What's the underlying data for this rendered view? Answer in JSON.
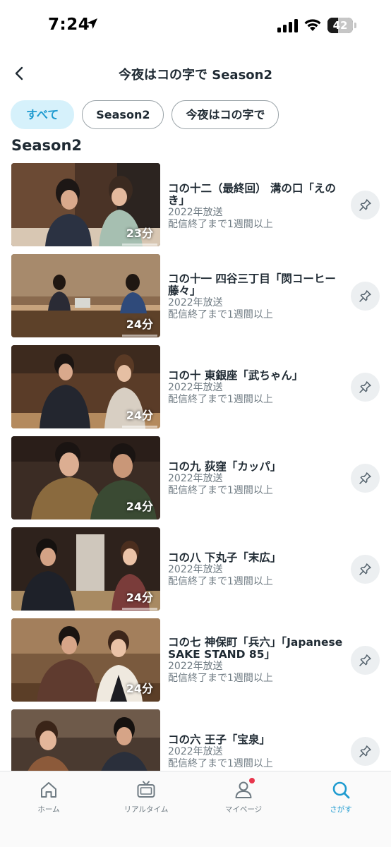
{
  "status_bar": {
    "time": "7:24",
    "battery": "42"
  },
  "header": {
    "title": "今夜はコの字で Season2"
  },
  "filters": [
    {
      "label": "すべて",
      "active": true
    },
    {
      "label": "Season2",
      "active": false
    },
    {
      "label": "今夜はコの字で",
      "active": false
    }
  ],
  "section": {
    "title": "Season2"
  },
  "episodes": [
    {
      "title": "コの十二（最終回） 溝の口「えのき」",
      "year": "2022年放送",
      "availability": "配信終了まで1週間以上",
      "duration": "23分"
    },
    {
      "title": "コの十一 四谷三丁目「焛コーヒー藤々」",
      "year": "2022年放送",
      "availability": "配信終了まで1週間以上",
      "duration": "24分"
    },
    {
      "title": "コの十 東銀座「武ちゃん」",
      "year": "2022年放送",
      "availability": "配信終了まで1週間以上",
      "duration": "24分"
    },
    {
      "title": "コの九 荻窪「カッパ」",
      "year": "2022年放送",
      "availability": "配信終了まで1週間以上",
      "duration": "24分"
    },
    {
      "title": "コの八 下丸子「末広」",
      "year": "2022年放送",
      "availability": "配信終了まで1週間以上",
      "duration": "24分"
    },
    {
      "title": "コの七 神保町「兵六」「Japanese SAKE STAND 85」",
      "year": "2022年放送",
      "availability": "配信終了まで1週間以上",
      "duration": "24分"
    },
    {
      "title": "コの六 王子「宝泉」",
      "year": "2022年放送",
      "availability": "配信終了まで1週間以上",
      "duration": ""
    }
  ],
  "tab_bar": {
    "items": [
      {
        "label": "ホーム",
        "icon": "home-icon"
      },
      {
        "label": "リアルタイム",
        "icon": "tv-icon"
      },
      {
        "label": "マイページ",
        "icon": "user-icon"
      },
      {
        "label": "さがす",
        "icon": "search-icon",
        "active": true
      }
    ]
  },
  "colors": {
    "accent": "#1e9bd0",
    "chip_active_bg": "#d6f1fb",
    "notification": "#e8364d"
  }
}
